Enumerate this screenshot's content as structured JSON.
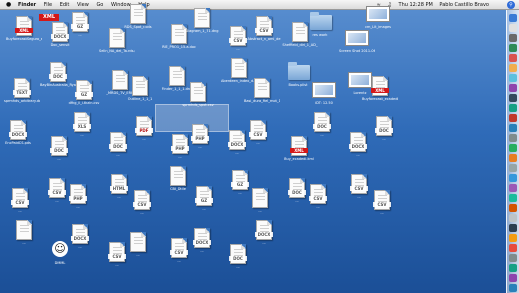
{
  "menubar": {
    "apple": "",
    "menus": [
      "Finder",
      "File",
      "Edit",
      "View",
      "Go",
      "Window",
      "Help"
    ],
    "clock": "Thu 12:28 PM",
    "user": "Pablo Castillo Bravo"
  },
  "badges": {
    "xml": "XML"
  },
  "colors": {
    "desktop_top": "#5a8fd0",
    "desktop_bottom": "#1b4f97",
    "xml_red": "#d41818"
  },
  "items": [
    {
      "kind": "doc",
      "tag": "XML",
      "label": "BuyforecastSeguro_ecadedi.kml"
    },
    {
      "kind": "doc",
      "tag": "DOCX",
      "label": "Doc_sensit"
    },
    {
      "kind": "doc",
      "tag": "GZ",
      "label": "..."
    },
    {
      "kind": "doc",
      "tag": "",
      "label": "Selin_NA_del_Ta.rds.gz"
    },
    {
      "kind": "doc",
      "tag": "",
      "label": "RDS_Spot_r.ods"
    },
    {
      "kind": "doc",
      "tag": "",
      "label": "RIE_PRO1_15.a.doc"
    },
    {
      "kind": "doc",
      "tag": "",
      "label": "Diagram_1_71.dng"
    },
    {
      "kind": "doc",
      "tag": "CSV",
      "label": "..."
    },
    {
      "kind": "doc",
      "tag": "CSV",
      "label": "Abstract_n_ami_de"
    },
    {
      "kind": "doc",
      "tag": "",
      "label": "Sheffield_diri_1_AD_"
    },
    {
      "kind": "folder",
      "tag": "",
      "label": "res work"
    },
    {
      "kind": "shot",
      "tag": "",
      "label": "Screen Shot 2011-06-...M.png"
    },
    {
      "kind": "shot",
      "tag": "",
      "label": "cm_Lit_images"
    },
    {
      "kind": "doc",
      "tag": "TEXT",
      "label": "sprmhds_arbitrary.doc"
    },
    {
      "kind": "doc",
      "tag": "DOC",
      "label": "BayBinAustralia_Ryan.doc"
    },
    {
      "kind": "doc",
      "tag": "GZ",
      "label": "dfhg_ll_i.tkzin.csv"
    },
    {
      "kind": "doc",
      "tag": "",
      "label": "_MRDS_TV_ERH"
    },
    {
      "kind": "doc",
      "tag": "",
      "label": "Outline_1_1_1"
    },
    {
      "kind": "doc",
      "tag": "",
      "label": "Finder_1_1_1.dng"
    },
    {
      "kind": "doc",
      "tag": "",
      "label": "sprmhds_spot.csv"
    },
    {
      "kind": "doc",
      "tag": "",
      "label": "Aberdeen_index_d.pro"
    },
    {
      "kind": "doc",
      "tag": "",
      "label": "Basi_dura_fiel_mot_1.tar"
    },
    {
      "kind": "folder",
      "tag": "",
      "label": "Books.plist"
    },
    {
      "kind": "shot",
      "tag": "",
      "label": "iDT: 12.50"
    },
    {
      "kind": "shot",
      "tag": "",
      "label": "Lorentz"
    },
    {
      "kind": "doc",
      "tag": "XML",
      "label": "Buyforecast_ecadedi.kml"
    },
    {
      "kind": "doc",
      "tag": "DOCX",
      "label": "EncPaidCS.pds"
    },
    {
      "kind": "doc",
      "tag": "DOC",
      "label": "..."
    },
    {
      "kind": "doc",
      "tag": "XLS",
      "label": "..."
    },
    {
      "kind": "doc",
      "tag": "DOC",
      "label": "..."
    },
    {
      "kind": "doc",
      "tag": "PDF",
      "label": "..."
    },
    {
      "kind": "doc",
      "tag": "PHP",
      "label": "..."
    },
    {
      "kind": "doc",
      "tag": "PHP",
      "label": "..."
    },
    {
      "kind": "doc",
      "tag": "DOCX",
      "label": "..."
    },
    {
      "kind": "doc",
      "tag": "CSV",
      "label": "..."
    },
    {
      "kind": "doc",
      "tag": "XML",
      "label": "Buy_ecadedi.kml"
    },
    {
      "kind": "doc",
      "tag": "DOC",
      "label": "..."
    },
    {
      "kind": "doc",
      "tag": "DOCX",
      "label": "..."
    },
    {
      "kind": "doc",
      "tag": "DOC",
      "label": "..."
    },
    {
      "kind": "doc",
      "tag": "CSV",
      "label": "..."
    },
    {
      "kind": "doc",
      "tag": "CSV",
      "label": "..."
    },
    {
      "kind": "doc",
      "tag": "PHP",
      "label": "..."
    },
    {
      "kind": "doc",
      "tag": "HTML",
      "label": "..."
    },
    {
      "kind": "doc",
      "tag": "CSV",
      "label": "..."
    },
    {
      "kind": "doc",
      "tag": "",
      "label": "CBI_Dtile"
    },
    {
      "kind": "doc",
      "tag": "GZ",
      "label": "..."
    },
    {
      "kind": "doc",
      "tag": "GZ",
      "label": "..."
    },
    {
      "kind": "doc",
      "tag": "",
      "label": "..."
    },
    {
      "kind": "doc",
      "tag": "DOC",
      "label": "..."
    },
    {
      "kind": "doc",
      "tag": "CSV",
      "label": "..."
    },
    {
      "kind": "doc",
      "tag": "CSV",
      "label": "..."
    },
    {
      "kind": "doc",
      "tag": "CSV",
      "label": "..."
    },
    {
      "kind": "doc",
      "tag": "",
      "label": "..."
    },
    {
      "kind": "smiley",
      "tag": "",
      "label": "DMML"
    },
    {
      "kind": "doc",
      "tag": "DOCX",
      "label": "..."
    },
    {
      "kind": "doc",
      "tag": "CSV",
      "label": "..."
    },
    {
      "kind": "doc",
      "tag": "",
      "label": "..."
    },
    {
      "kind": "doc",
      "tag": "CSV",
      "label": "..."
    },
    {
      "kind": "doc",
      "tag": "DOCX",
      "label": "..."
    },
    {
      "kind": "doc",
      "tag": "DOC",
      "label": "..."
    },
    {
      "kind": "doc",
      "tag": "DOCX",
      "label": "..."
    }
  ]
}
